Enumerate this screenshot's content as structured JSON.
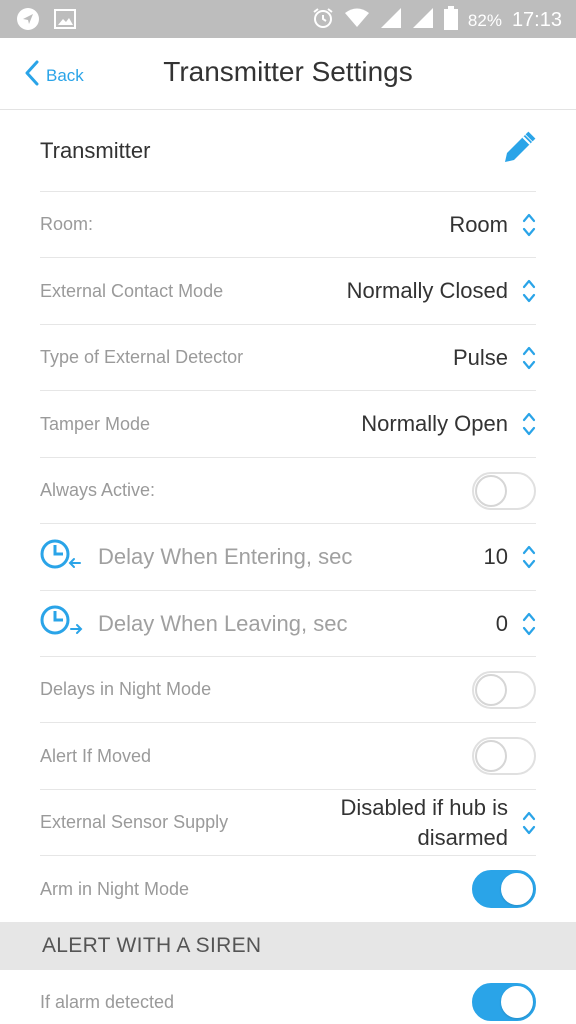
{
  "status_bar": {
    "left_icons": [
      "navigation-icon",
      "image-icon"
    ],
    "right_icons": [
      "alarm-icon",
      "wifi-icon",
      "signal-icon",
      "signal-icon",
      "battery-icon"
    ],
    "battery": "82%",
    "time": "17:13"
  },
  "nav": {
    "back_label": "Back",
    "title": "Transmitter Settings"
  },
  "device": {
    "name": "Transmitter",
    "edit_icon": "pencil-icon"
  },
  "settings": {
    "room_label": "Room:",
    "room_value": "Room",
    "contact_mode_label": "External Contact Mode",
    "contact_mode_value": "Normally Closed",
    "detector_type_label": "Type of External Detector",
    "detector_type_value": "Pulse",
    "tamper_label": "Tamper Mode",
    "tamper_value": "Normally Open",
    "always_active_label": "Always Active:",
    "always_active_on": false,
    "delay_entering_label": "Delay When Entering, sec",
    "delay_entering_value": "10",
    "delay_leaving_label": "Delay When Leaving, sec",
    "delay_leaving_value": "0",
    "night_delays_label": "Delays in Night Mode",
    "night_delays_on": false,
    "alert_moved_label": "Alert If Moved",
    "alert_moved_on": false,
    "sensor_supply_label": "External Sensor Supply",
    "sensor_supply_line1": "Disabled if hub is",
    "sensor_supply_line2": "disarmed",
    "arm_night_label": "Arm in Night Mode",
    "arm_night_on": true
  },
  "siren_section": {
    "header": "ALERT WITH A SIREN",
    "alarm_detected_label": "If alarm detected",
    "alarm_detected_on": true
  },
  "colors": {
    "accent": "#2aa4e8",
    "status_bar": "#bdbdbd",
    "section_bg": "#e6e6e6"
  }
}
